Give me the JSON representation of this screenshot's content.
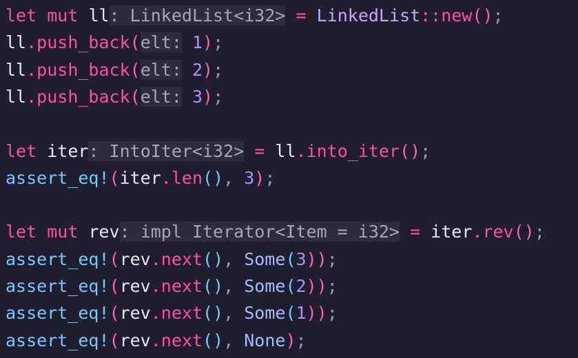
{
  "editor": {
    "background": "#1e1e2e",
    "lines": [
      [
        {
          "t": "let",
          "c": "kw"
        },
        {
          "t": " ",
          "c": "plain"
        },
        {
          "t": "mut",
          "c": "kw"
        },
        {
          "t": " ",
          "c": "plain"
        },
        {
          "t": "ll",
          "c": "plain"
        },
        {
          "t": ": LinkedList<i32>",
          "c": "hint"
        },
        {
          "t": " ",
          "c": "plain"
        },
        {
          "t": "=",
          "c": "kw"
        },
        {
          "t": " ",
          "c": "plain"
        },
        {
          "t": "LinkedList",
          "c": "type"
        },
        {
          "t": "::",
          "c": "kw"
        },
        {
          "t": "new",
          "c": "fn"
        },
        {
          "t": "()",
          "c": "paren"
        },
        {
          "t": ";",
          "c": "punct"
        }
      ],
      [
        {
          "t": "ll",
          "c": "plain"
        },
        {
          "t": ".",
          "c": "kw"
        },
        {
          "t": "push_back",
          "c": "fn"
        },
        {
          "t": "(",
          "c": "paren"
        },
        {
          "t": "elt:",
          "c": "hint"
        },
        {
          "t": " ",
          "c": "plain"
        },
        {
          "t": "1",
          "c": "num"
        },
        {
          "t": ")",
          "c": "paren"
        },
        {
          "t": ";",
          "c": "punct"
        }
      ],
      [
        {
          "t": "ll",
          "c": "plain"
        },
        {
          "t": ".",
          "c": "kw"
        },
        {
          "t": "push_back",
          "c": "fn"
        },
        {
          "t": "(",
          "c": "paren"
        },
        {
          "t": "elt:",
          "c": "hint"
        },
        {
          "t": " ",
          "c": "plain"
        },
        {
          "t": "2",
          "c": "num"
        },
        {
          "t": ")",
          "c": "paren"
        },
        {
          "t": ";",
          "c": "punct"
        }
      ],
      [
        {
          "t": "ll",
          "c": "plain"
        },
        {
          "t": ".",
          "c": "kw"
        },
        {
          "t": "push_back",
          "c": "fn"
        },
        {
          "t": "(",
          "c": "paren"
        },
        {
          "t": "elt:",
          "c": "hint"
        },
        {
          "t": " ",
          "c": "plain"
        },
        {
          "t": "3",
          "c": "num"
        },
        {
          "t": ")",
          "c": "paren"
        },
        {
          "t": ";",
          "c": "punct"
        }
      ],
      [],
      [
        {
          "t": "let",
          "c": "kw"
        },
        {
          "t": " ",
          "c": "plain"
        },
        {
          "t": "iter",
          "c": "plain"
        },
        {
          "t": ": IntoIter<i32>",
          "c": "hint"
        },
        {
          "t": " ",
          "c": "plain"
        },
        {
          "t": "=",
          "c": "kw"
        },
        {
          "t": " ",
          "c": "plain"
        },
        {
          "t": "ll",
          "c": "plain"
        },
        {
          "t": ".",
          "c": "kw"
        },
        {
          "t": "into_iter",
          "c": "fn"
        },
        {
          "t": "()",
          "c": "paren"
        },
        {
          "t": ";",
          "c": "punct"
        }
      ],
      [
        {
          "t": "assert_eq!",
          "c": "macro"
        },
        {
          "t": "(",
          "c": "paren"
        },
        {
          "t": "iter",
          "c": "plain"
        },
        {
          "t": ".",
          "c": "kw"
        },
        {
          "t": "len",
          "c": "fn"
        },
        {
          "t": "()",
          "c": "macro"
        },
        {
          "t": ", ",
          "c": "punct"
        },
        {
          "t": "3",
          "c": "num"
        },
        {
          "t": ")",
          "c": "paren"
        },
        {
          "t": ";",
          "c": "punct"
        }
      ],
      [],
      [
        {
          "t": "let",
          "c": "kw"
        },
        {
          "t": " ",
          "c": "plain"
        },
        {
          "t": "mut",
          "c": "kw"
        },
        {
          "t": " ",
          "c": "plain"
        },
        {
          "t": "rev",
          "c": "plain"
        },
        {
          "t": ": impl Iterator<Item = i32>",
          "c": "hint"
        },
        {
          "t": " ",
          "c": "plain"
        },
        {
          "t": "=",
          "c": "kw"
        },
        {
          "t": " ",
          "c": "plain"
        },
        {
          "t": "iter",
          "c": "plain"
        },
        {
          "t": ".",
          "c": "kw"
        },
        {
          "t": "rev",
          "c": "fn"
        },
        {
          "t": "()",
          "c": "paren"
        },
        {
          "t": ";",
          "c": "punct"
        }
      ],
      [
        {
          "t": "assert_eq!",
          "c": "macro"
        },
        {
          "t": "(",
          "c": "paren"
        },
        {
          "t": "rev",
          "c": "plain"
        },
        {
          "t": ".",
          "c": "kw"
        },
        {
          "t": "next",
          "c": "fn"
        },
        {
          "t": "()",
          "c": "macro"
        },
        {
          "t": ", ",
          "c": "punct"
        },
        {
          "t": "Some",
          "c": "some"
        },
        {
          "t": "(",
          "c": "macro"
        },
        {
          "t": "3",
          "c": "num"
        },
        {
          "t": "))",
          "c": "paren"
        },
        {
          "t": ";",
          "c": "punct"
        }
      ],
      [
        {
          "t": "assert_eq!",
          "c": "macro"
        },
        {
          "t": "(",
          "c": "paren"
        },
        {
          "t": "rev",
          "c": "plain"
        },
        {
          "t": ".",
          "c": "kw"
        },
        {
          "t": "next",
          "c": "fn"
        },
        {
          "t": "()",
          "c": "macro"
        },
        {
          "t": ", ",
          "c": "punct"
        },
        {
          "t": "Some",
          "c": "some"
        },
        {
          "t": "(",
          "c": "macro"
        },
        {
          "t": "2",
          "c": "num"
        },
        {
          "t": "))",
          "c": "paren"
        },
        {
          "t": ";",
          "c": "punct"
        }
      ],
      [
        {
          "t": "assert_eq!",
          "c": "macro"
        },
        {
          "t": "(",
          "c": "paren"
        },
        {
          "t": "rev",
          "c": "plain"
        },
        {
          "t": ".",
          "c": "kw"
        },
        {
          "t": "next",
          "c": "fn"
        },
        {
          "t": "()",
          "c": "macro"
        },
        {
          "t": ", ",
          "c": "punct"
        },
        {
          "t": "Some",
          "c": "some"
        },
        {
          "t": "(",
          "c": "macro"
        },
        {
          "t": "1",
          "c": "num"
        },
        {
          "t": "))",
          "c": "paren"
        },
        {
          "t": ";",
          "c": "punct"
        }
      ],
      [
        {
          "t": "assert_eq!",
          "c": "macro"
        },
        {
          "t": "(",
          "c": "paren"
        },
        {
          "t": "rev",
          "c": "plain"
        },
        {
          "t": ".",
          "c": "kw"
        },
        {
          "t": "next",
          "c": "fn"
        },
        {
          "t": "()",
          "c": "macro"
        },
        {
          "t": ", ",
          "c": "punct"
        },
        {
          "t": "None",
          "c": "some"
        },
        {
          "t": ")",
          "c": "paren"
        },
        {
          "t": ";",
          "c": "punct"
        }
      ]
    ]
  }
}
